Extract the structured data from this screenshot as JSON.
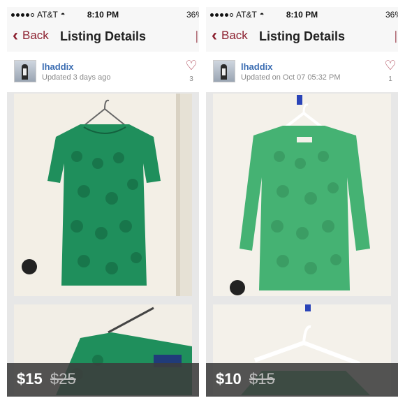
{
  "status_bar": {
    "carrier": "AT&T",
    "time": "8:10 PM",
    "battery": "36%"
  },
  "nav": {
    "back_label": "Back",
    "title": "Listing Details"
  },
  "listings": [
    {
      "username": "lhaddix",
      "updated": "Updated 3 days ago",
      "like_count": "3",
      "price": "$15",
      "original_price": "$25",
      "shirt_color": "#1f8f5c"
    },
    {
      "username": "lhaddix",
      "updated": "Updated on Oct 07 05:32 PM",
      "like_count": "1",
      "price": "$10",
      "original_price": "$15",
      "shirt_color": "#45b273"
    }
  ],
  "icons": {
    "back": "chevron-left-icon",
    "like": "heart-icon",
    "wifi": "wifi-icon"
  }
}
